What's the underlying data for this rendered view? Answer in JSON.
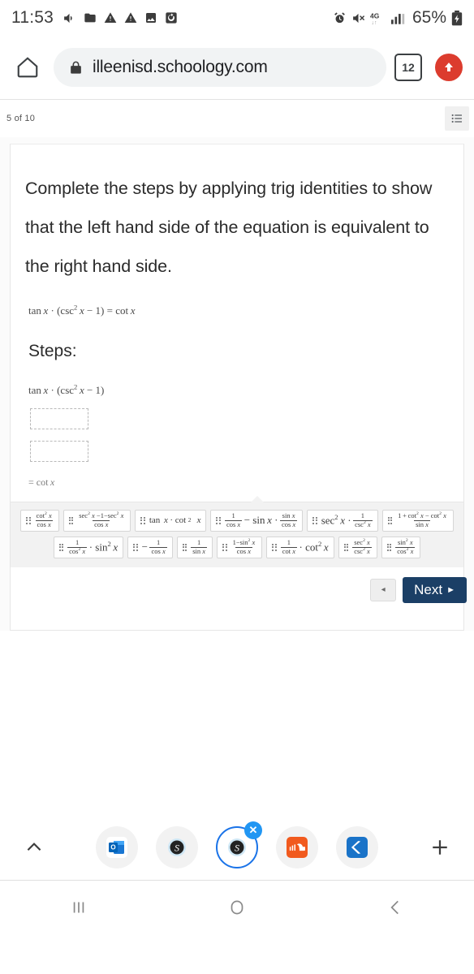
{
  "status_bar": {
    "time": "11:53",
    "battery_percent": "65%",
    "network": "4G",
    "left_icons": [
      "volume-icon",
      "folder-icon",
      "warning-icon",
      "warning-icon-2",
      "image-icon",
      "sync-icon"
    ],
    "right_icons": [
      "alarm-icon",
      "mute-icon",
      "network-4g-icon",
      "signal-bars-icon",
      "battery-charging-icon"
    ]
  },
  "browser": {
    "home_icon": "home-icon",
    "lock_icon": "lock-icon",
    "url": "illeenisd.schoology.com",
    "tab_count": "12",
    "update_icon": "upload-arrow-icon"
  },
  "page": {
    "counter": "5 of 10",
    "list_icon": "list-view-icon",
    "question": "Complete the steps by applying trig identities to show that the left hand side of the equation is equivalent to the right hand side.",
    "main_equation": "tan x · (csc² x − 1) = cot x",
    "steps_label": "Steps:",
    "step_expression": "tan x · (csc² x − 1)",
    "dropzones": [
      "",
      ""
    ],
    "result_expression": "= cot x"
  },
  "answer_bank": {
    "rows": [
      [
        {
          "id": "tile-1",
          "latex": "cot² x / cos x"
        },
        {
          "id": "tile-2",
          "latex": "(sec² x − 1 − sec² x) / cos x"
        },
        {
          "id": "tile-3",
          "latex": "tan x · cot² x"
        },
        {
          "id": "tile-4",
          "latex": "1/cos x − sin x · sin x/cos x"
        },
        {
          "id": "tile-5",
          "latex": "sec² x · 1/csc² x"
        },
        {
          "id": "tile-6",
          "latex": "(1 + cot² x − cot² x) / sin x"
        }
      ],
      [
        {
          "id": "tile-7",
          "latex": "1/cos² x · sin² x"
        },
        {
          "id": "tile-8",
          "latex": "− 1/cos x"
        },
        {
          "id": "tile-9",
          "latex": "1/sin x"
        },
        {
          "id": "tile-10",
          "latex": "(1 − sin² x) / cos x"
        },
        {
          "id": "tile-11",
          "latex": "1/cot x · cot² x"
        },
        {
          "id": "tile-12",
          "latex": "sec² x / csc² x"
        },
        {
          "id": "tile-13",
          "latex": "sin² x / cos² x"
        }
      ]
    ]
  },
  "navigation": {
    "back_label": "◂",
    "next_label": "Next",
    "next_arrow": "►"
  },
  "app_switcher": {
    "collapse_icon": "chevron-up-icon",
    "apps": [
      {
        "name": "outlook",
        "selected": false
      },
      {
        "name": "skype",
        "selected": false
      },
      {
        "name": "skype-active",
        "selected": true,
        "close_label": "✕"
      },
      {
        "name": "soundcloud",
        "selected": false
      },
      {
        "name": "kami",
        "selected": false
      }
    ],
    "add_label": "+"
  },
  "system_nav": {
    "recents_icon": "recents-icon",
    "home_icon": "home-circle-icon",
    "back_icon": "back-chevron-icon"
  },
  "colors": {
    "accent_blue": "#1a73e8",
    "next_button": "#1b3f66",
    "update_red": "#dc3c2e",
    "bank_bg": "#f2f2f2"
  }
}
